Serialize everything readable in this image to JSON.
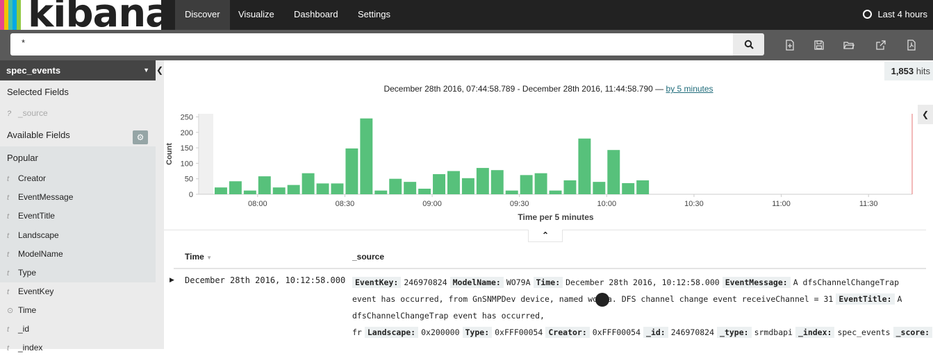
{
  "brand": {
    "name": "kibana",
    "stripes": [
      "#e8478b",
      "#f2c400",
      "#3ebeb0",
      "#00a9e5",
      "#90c940"
    ]
  },
  "nav": {
    "tabs": [
      {
        "label": "Discover",
        "active": true
      },
      {
        "label": "Visualize"
      },
      {
        "label": "Dashboard"
      },
      {
        "label": "Settings"
      }
    ],
    "timepicker": "Last 4 hours"
  },
  "search": {
    "value": "*"
  },
  "toolbar": {
    "icons": [
      "new-search-icon",
      "save-icon",
      "open-icon",
      "share-icon",
      "report-icon"
    ]
  },
  "sidebar": {
    "index_pattern": "spec_events",
    "selected_fields_title": "Selected Fields",
    "selected_fields": [
      {
        "type": "?",
        "name": "_source"
      }
    ],
    "available_fields_title": "Available Fields",
    "popular_title": "Popular",
    "popular_fields": [
      {
        "type": "t",
        "name": "Creator"
      },
      {
        "type": "t",
        "name": "EventMessage"
      },
      {
        "type": "t",
        "name": "EventTitle"
      },
      {
        "type": "t",
        "name": "Landscape"
      },
      {
        "type": "t",
        "name": "ModelName"
      },
      {
        "type": "t",
        "name": "Type"
      }
    ],
    "other_fields": [
      {
        "type": "t",
        "name": "EventKey"
      },
      {
        "type": "clock",
        "name": "Time"
      },
      {
        "type": "t",
        "name": "_id"
      },
      {
        "type": "t",
        "name": "_index"
      }
    ]
  },
  "hits": {
    "count": "1,853",
    "label": "hits"
  },
  "time_range": {
    "text": "December 28th 2016, 07:44:58.789 - December 28th 2016, 11:44:58.790 —",
    "interval": "by 5 minutes"
  },
  "chart_data": {
    "type": "bar",
    "ylabel": "Count",
    "xlabel": "Time per 5 minutes",
    "ylim": [
      0,
      260
    ],
    "yticks": [
      0,
      50,
      100,
      150,
      200,
      250
    ],
    "xticks": [
      "08:00",
      "08:30",
      "09:00",
      "09:30",
      "10:00",
      "10:30",
      "11:00",
      "11:30"
    ],
    "bar_color": "#57c17b",
    "x_start_minutes": 0,
    "x_end_minutes": 240,
    "bars": [
      {
        "t": 0,
        "v": 22
      },
      {
        "t": 5,
        "v": 42
      },
      {
        "t": 10,
        "v": 12
      },
      {
        "t": 15,
        "v": 58
      },
      {
        "t": 20,
        "v": 22
      },
      {
        "t": 25,
        "v": 30
      },
      {
        "t": 30,
        "v": 68
      },
      {
        "t": 35,
        "v": 35
      },
      {
        "t": 40,
        "v": 35
      },
      {
        "t": 45,
        "v": 148
      },
      {
        "t": 50,
        "v": 245
      },
      {
        "t": 55,
        "v": 12
      },
      {
        "t": 60,
        "v": 50
      },
      {
        "t": 65,
        "v": 40
      },
      {
        "t": 70,
        "v": 18
      },
      {
        "t": 75,
        "v": 65
      },
      {
        "t": 80,
        "v": 75
      },
      {
        "t": 85,
        "v": 52
      },
      {
        "t": 90,
        "v": 85
      },
      {
        "t": 95,
        "v": 78
      },
      {
        "t": 100,
        "v": 12
      },
      {
        "t": 105,
        "v": 62
      },
      {
        "t": 110,
        "v": 68
      },
      {
        "t": 115,
        "v": 12
      },
      {
        "t": 120,
        "v": 45
      },
      {
        "t": 125,
        "v": 180
      },
      {
        "t": 130,
        "v": 40
      },
      {
        "t": 135,
        "v": 143
      },
      {
        "t": 140,
        "v": 36
      },
      {
        "t": 145,
        "v": 45
      }
    ]
  },
  "table": {
    "headers": {
      "time": "Time",
      "source": "_source"
    },
    "rows": [
      {
        "time": "December 28th 2016, 10:12:58.000",
        "fields": [
          {
            "k": "EventKey:",
            "v": "246970824"
          },
          {
            "k": "ModelName:",
            "v": "WO79A"
          },
          {
            "k": "Time:",
            "v": "December 28th 2016, 10:12:58.000"
          },
          {
            "k": "EventMessage:",
            "v": "A dfsChannelChangeTrap event has occurred, from GnSNMPDev device, named wo79a. DFS channel change event receiveChannel = 31"
          },
          {
            "k": "EventTitle:",
            "v": "A dfsChannelChangeTrap event has occurred, fr"
          },
          {
            "k": "Landscape:",
            "v": "0x200000"
          },
          {
            "k": "Type:",
            "v": "0xFFF00054"
          },
          {
            "k": "Creator:",
            "v": "0xFFF00054"
          },
          {
            "k": "_id:",
            "v": "246970824"
          },
          {
            "k": "_type:",
            "v": "srmdbapi"
          },
          {
            "k": "_index:",
            "v": "spec_events"
          },
          {
            "k": "_score:",
            "v": ""
          }
        ]
      }
    ]
  }
}
